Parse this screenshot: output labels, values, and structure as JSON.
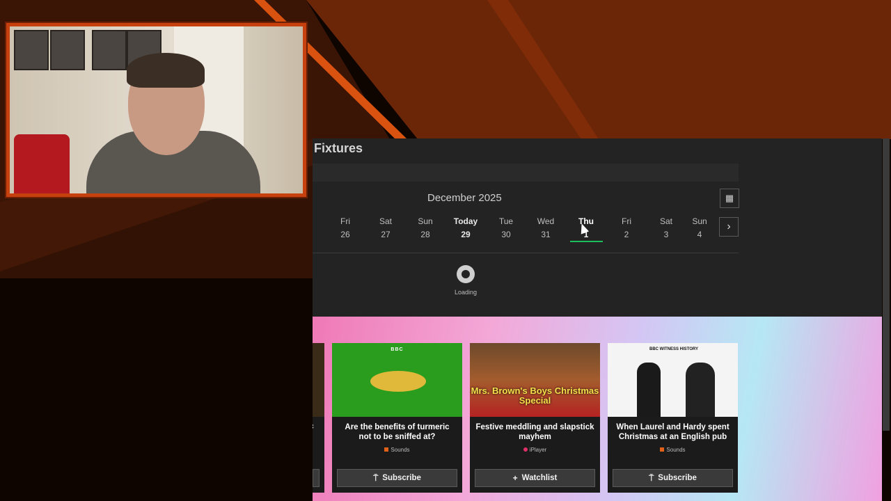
{
  "fixtures": {
    "title": "Fixtures",
    "month": "December 2025",
    "calendar_icon": "calendar-icon",
    "next_icon": "chevron-right-icon",
    "selected_underline_color": "#1dbf5a",
    "days": [
      {
        "name": "Fri",
        "num": "26"
      },
      {
        "name": "Sat",
        "num": "27"
      },
      {
        "name": "Sun",
        "num": "28"
      },
      {
        "name": "Today",
        "num": "29"
      },
      {
        "name": "Tue",
        "num": "30"
      },
      {
        "name": "Wed",
        "num": "31"
      },
      {
        "name": "Thu",
        "num": "1"
      },
      {
        "name": "Fri",
        "num": "2"
      },
      {
        "name": "Sat",
        "num": "3"
      },
      {
        "name": "Sun",
        "num": "4"
      }
    ],
    "loading_text": "Loading"
  },
  "promo": {
    "partial_card": {
      "title_fragment": "ic"
    },
    "cards": [
      {
        "badge": "BBC",
        "title": "Are the benefits of turmeric not to be sniffed at?",
        "source": "Sounds",
        "button": "Subscribe",
        "button_icon": "subscribe-icon"
      },
      {
        "badge": "Mrs. Brown's Boys Christmas Special",
        "title": "Festive meddling and slapstick mayhem",
        "source": "iPlayer",
        "button": "Watchlist",
        "button_icon": "plus-icon"
      },
      {
        "badge": "BBC WITNESS HISTORY",
        "title": "When Laurel and Hardy spent Christmas at an English pub",
        "source": "Sounds",
        "button": "Subscribe",
        "button_icon": "subscribe-icon"
      }
    ]
  },
  "colors": {
    "accent_orange": "#c7410f",
    "panel_bg": "#232323",
    "sounds": "#e0621a",
    "iplayer": "#e0306a"
  }
}
